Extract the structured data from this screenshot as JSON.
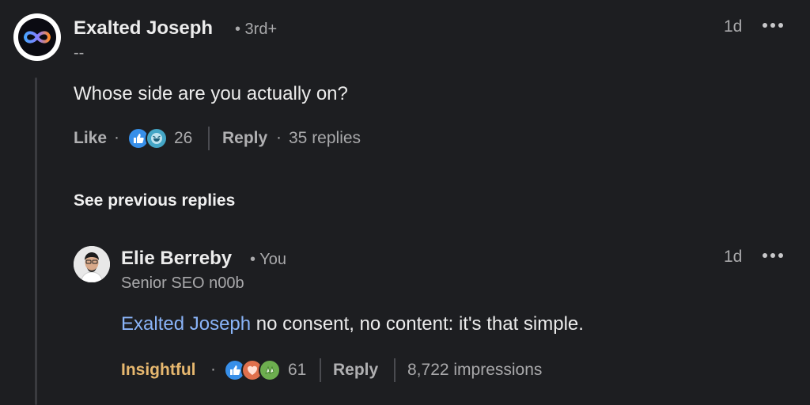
{
  "comment": {
    "author": "Exalted Joseph",
    "degree": "• 3rd+",
    "headline": "--",
    "time": "1d",
    "text": "Whose side are you actually on?",
    "like_label": "Like",
    "sep1": "·",
    "reaction_count": "26",
    "reply_label": "Reply",
    "sep2": "·",
    "replies_count": "35 replies"
  },
  "see_previous_label": "See previous replies",
  "reply": {
    "author": "Elie Berreby",
    "relation": "• You",
    "headline": "Senior SEO n00b",
    "time": "1d",
    "mention": "Exalted Joseph",
    "text": " no consent, no content: it's that simple.",
    "reaction_label": "Insightful",
    "sep": "·",
    "reaction_count": "61",
    "reply_label": "Reply",
    "impressions": "8,722 impressions"
  },
  "colors": {
    "background": "#1d1e21",
    "mention": "#8ab4f8",
    "insightful": "#e7b86f",
    "like_blue": "#378fe9",
    "funny_teal": "#44a6c6",
    "love_red": "#df704d",
    "celebrate_green": "#6dae4f"
  },
  "icons": [
    "menu-dots-icon",
    "like-reaction-icon",
    "funny-reaction-icon",
    "love-reaction-icon",
    "celebrate-reaction-icon"
  ]
}
